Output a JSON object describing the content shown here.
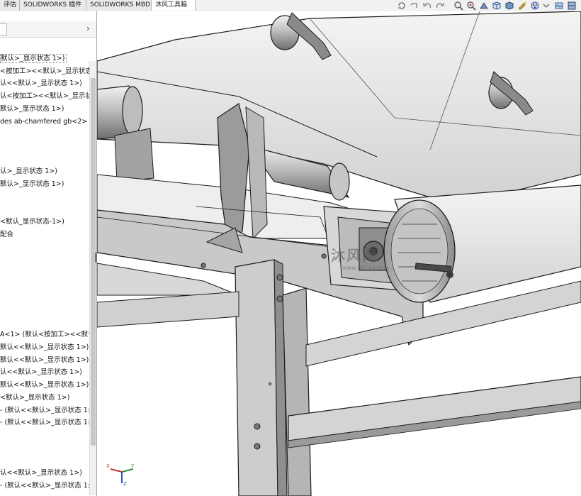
{
  "tabs": [
    {
      "label": "评估"
    },
    {
      "label": "SOLIDWORKS 插件"
    },
    {
      "label": "SOLIDWORKS MBD"
    },
    {
      "label": "沐风工具箱"
    }
  ],
  "panel": {
    "expand_arrow": "›",
    "tree_items": [
      {
        "label": "默认>_显示状态 1>)"
      },
      {
        "label": "<按加工><<默认>_显示状态"
      },
      {
        "label": "认<<默认>_显示状态 1>)"
      },
      {
        "label": "认<按加工><<默认>_显示状"
      },
      {
        "label": "默认>_显示状态 1>)"
      },
      {
        "label": "des ab-chamfered gb<2>"
      },
      {
        "label": "认>_显示状态 1>)"
      },
      {
        "label": "默认>_显示状态 1>)"
      },
      {
        "label": "<默认_显示状态-1>)"
      },
      {
        "label": "配合"
      },
      {
        "label": "A<1> (默认<按加工><<默认"
      },
      {
        "label": "默认<<默认>_显示状态 1>)"
      },
      {
        "label": "默认<<默认>_显示状态 1>)"
      },
      {
        "label": "认<<默认>_显示状态 1>)"
      },
      {
        "label": "默认<<默认>_显示状态 1>)"
      },
      {
        "label": "<默认>_显示状态 1>)"
      },
      {
        "label": "- (默认<<默认>_显示状态 1:"
      },
      {
        "label": "- (默认<<默认>_显示状态 1:"
      },
      {
        "label": "认<<默认>_显示状态 1>)"
      },
      {
        "label": "- (默认<<默认>_显示状态 1:"
      }
    ]
  },
  "watermark": {
    "main": "沐风网",
    "sub": "www.mfcad.com"
  },
  "triad": {
    "x": "X",
    "y": "Y",
    "z": "Z"
  },
  "colors": {
    "metal_light": "#d3d3d3",
    "metal_mid": "#a8a8a8",
    "metal_dark": "#5c5c5c",
    "outline": "#1c1c1c"
  }
}
